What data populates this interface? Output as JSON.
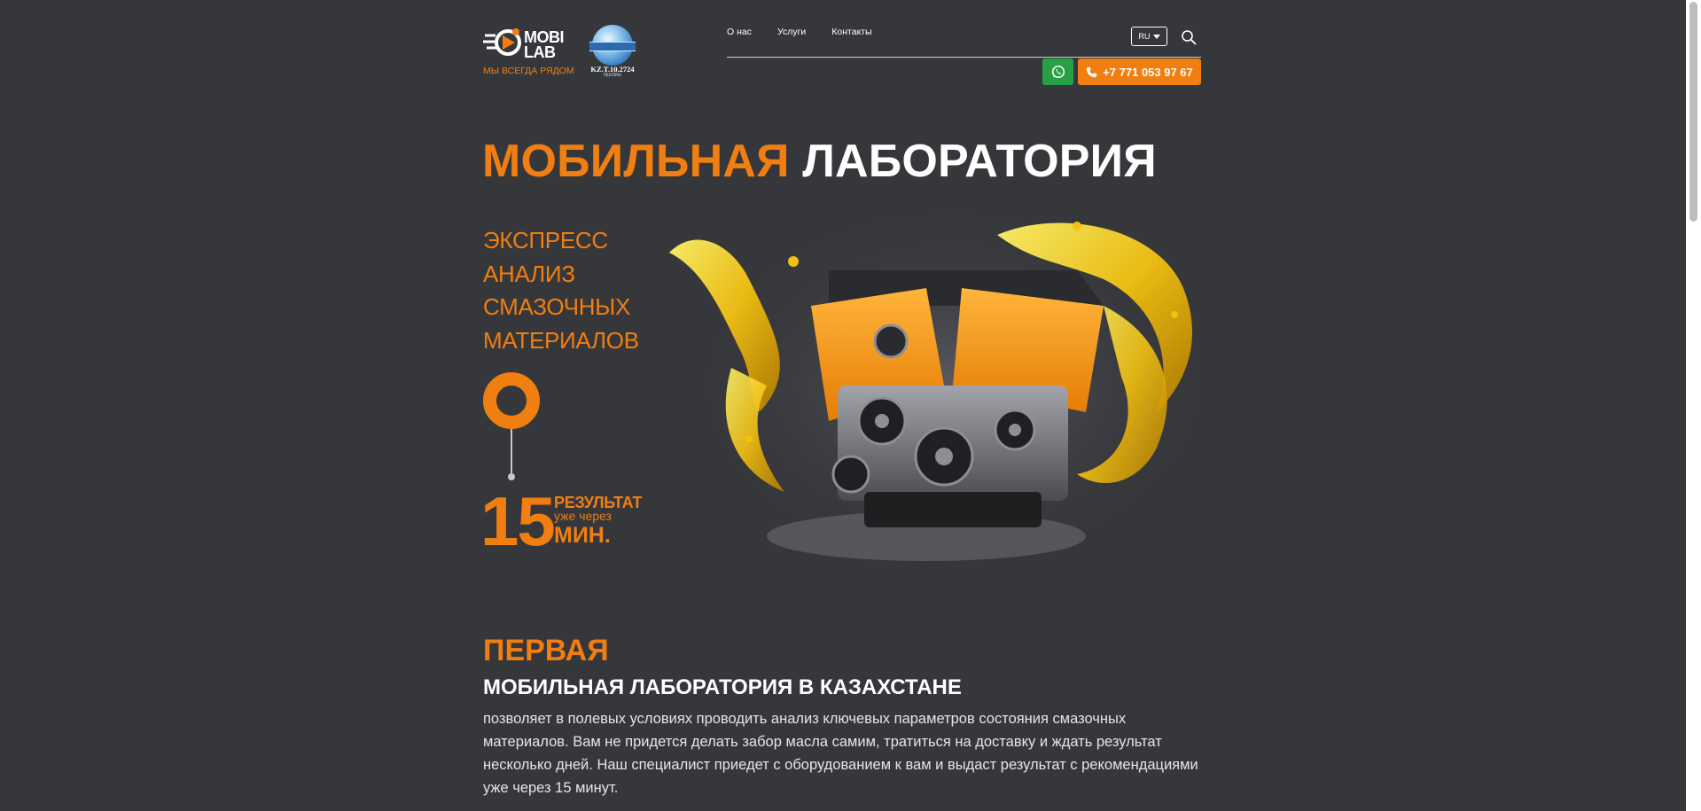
{
  "header": {
    "logo_text_line1": "MOBI",
    "logo_text_line2": "LAB",
    "tagline": "МЫ ВСЕГДА РЯДОМ",
    "cert_code": "KZ.T.10.2724",
    "cert_sub": "TESTING",
    "nav": [
      {
        "label": "О нас"
      },
      {
        "label": "Услуги"
      },
      {
        "label": "Контакты"
      }
    ],
    "language": "RU",
    "phone": "+7 771 053 97 67",
    "search_icon": "search-icon",
    "whatsapp_icon": "whatsapp-icon",
    "phone_icon": "phone-icon"
  },
  "hero": {
    "title_orange": "МОБИЛЬНАЯ",
    "title_white": "ЛАБОРАТОРИЯ",
    "subtitle_lines": [
      "ЭКСПРЕСС",
      "АНАЛИЗ",
      "СМАЗОЧНЫХ",
      "МАТЕРИАЛОВ"
    ],
    "number": "15",
    "result_label": "РЕЗУЛЬТАТ",
    "result_sub": "уже через",
    "result_unit": "МИН."
  },
  "intro": {
    "heading": "ПЕРВАЯ",
    "subheading": "МОБИЛЬНАЯ ЛАБОРАТОРИЯ В КАЗАХСТАНЕ",
    "text": "позволяет в полевых условиях проводить анализ ключевых параметров состояния смазочных материалов. Вам не придется делать забор масла самим, тратиться на доставку и ждать результат несколько дней. Наш специалист приедет с оборудованием к вам и выдаст результат с рекомендациями уже через 15 минут."
  },
  "colors": {
    "background": "#36373b",
    "accent": "#f07e11",
    "whatsapp": "#27a044"
  }
}
